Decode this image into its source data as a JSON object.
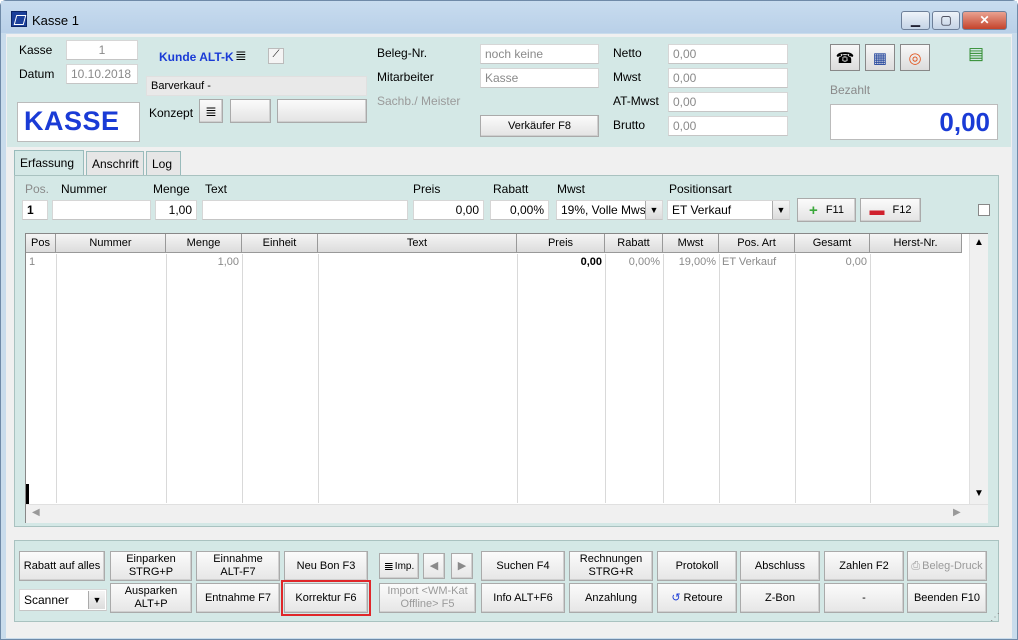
{
  "window": {
    "title": "Kasse 1"
  },
  "header": {
    "kasse_label": "Kasse",
    "kasse_value": "1",
    "datum_label": "Datum",
    "datum_value": "10.10.2018",
    "kunde_label": "Kunde ALT-K",
    "kunde_name": "Barverkauf -",
    "konzept_label": "Konzept",
    "big_title": "KASSE",
    "beleg_label": "Beleg-Nr.",
    "beleg_value": "noch keine",
    "mitarbeiter_label": "Mitarbeiter",
    "mitarbeiter_value": "Kasse",
    "sachb_label": "Sachb./ Meister",
    "verkaeufer_button": "Verkäufer F8",
    "netto_label": "Netto",
    "netto_value": "0,00",
    "mwst_label": "Mwst",
    "mwst_value": "0,00",
    "atmwst_label": "AT-Mwst",
    "atmwst_value": "0,00",
    "brutto_label": "Brutto",
    "brutto_value": "0,00",
    "bezahlt_label": "Bezahlt",
    "bezahlt_value": "0,00"
  },
  "tabs": [
    "Erfassung",
    "Anschrift",
    "Log"
  ],
  "entry": {
    "pos_label": "Pos.",
    "pos_value": "1",
    "nummer_label": "Nummer",
    "menge_label": "Menge",
    "menge_value": "1,00",
    "text_label": "Text",
    "preis_label": "Preis",
    "preis_value": "0,00",
    "rabatt_label": "Rabatt",
    "rabatt_value": "0,00%",
    "mwst_label": "Mwst",
    "mwst_value": "19%, Volle Mws",
    "positionsart_label": "Positionsart",
    "positionsart_value": "ET Verkauf",
    "add_button": "F11",
    "remove_button": "F12"
  },
  "grid": {
    "columns": [
      "Pos",
      "Nummer",
      "Menge",
      "Einheit",
      "Text",
      "Preis",
      "Rabatt",
      "Mwst",
      "Pos. Art",
      "Gesamt",
      "Herst-Nr."
    ],
    "rows": [
      {
        "pos": "1",
        "nummer": "",
        "menge": "1,00",
        "einheit": "",
        "text": "",
        "preis": "0,00",
        "rabatt": "0,00%",
        "mwst": "19,00%",
        "posart": "ET Verkauf",
        "gesamt": "0,00",
        "herst": ""
      }
    ]
  },
  "footer": {
    "rabatt_all": "Rabatt auf alles",
    "scanner": "Scanner",
    "einparken_1": "Einparken",
    "einparken_2": "STRG+P",
    "ausparken_1": "Ausparken",
    "ausparken_2": "ALT+P",
    "einnahme_1": "Einnahme",
    "einnahme_2": "ALT-F7",
    "entnahme": "Entnahme F7",
    "neu_bon": "Neu Bon F3",
    "korrektur": "Korrektur F6",
    "imp": "Imp.",
    "import_1": "Import <WM-Kat",
    "import_2": "Offline> F5",
    "suchen": "Suchen F4",
    "info": "Info ALT+F6",
    "rechnungen_1": "Rechnungen",
    "rechnungen_2": "STRG+R",
    "anzahlung": "Anzahlung",
    "protokoll": "Protokoll",
    "retoure": "Retoure",
    "abschluss": "Abschluss",
    "zbon": "Z-Bon",
    "zahlen": "Zahlen F2",
    "dash": "-",
    "beleg_druck": "Beleg-Druck",
    "beenden": "Beenden F10"
  },
  "colors": {
    "accent_blue": "#1a3bd6",
    "panel": "#d4e8e6",
    "highlight": "#e0272a"
  }
}
